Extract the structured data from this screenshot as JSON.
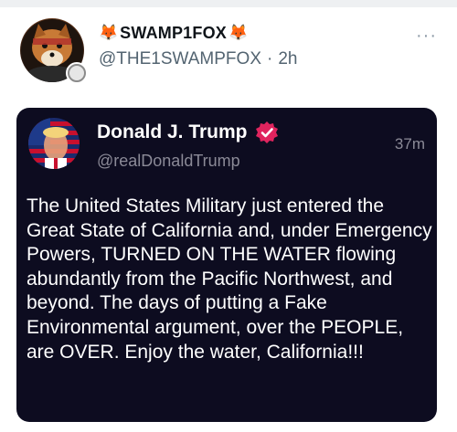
{
  "post": {
    "display_name": "SWAMP1FOX",
    "name_emoji": "🦊",
    "handle": "@THE1SWAMPFOX",
    "separator": "·",
    "time": "2h",
    "more_label": "···"
  },
  "quoted": {
    "display_name": "Donald J. Trump",
    "handle": "@realDonaldTrump",
    "time": "37m",
    "text": "The United States Military just entered the Great State of California and, under Emergency Powers, TURNED ON THE WATER flowing abundantly from the Pacific Northwest, and beyond. The days of putting a Fake Environmental argument, over the PEOPLE, are OVER. Enjoy the water, California!!!",
    "card_bg": "#0d0c20",
    "verified_color": "#e0245e"
  },
  "icons": {
    "avatar": "fox-avatar",
    "badge": "badge-icon",
    "verified": "verified-badge-icon",
    "more": "more-icon"
  }
}
